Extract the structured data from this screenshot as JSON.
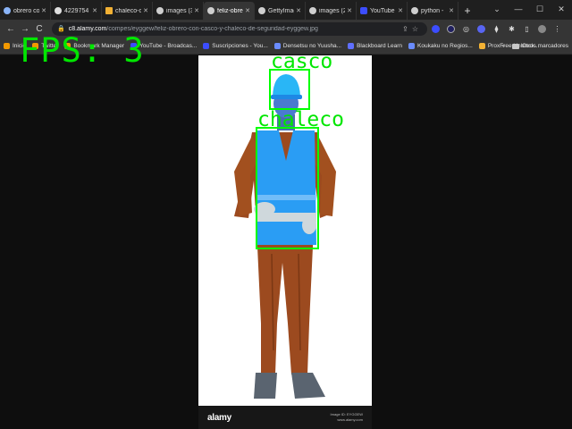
{
  "tabs": [
    {
      "title": "obrero co",
      "color": "#8ab4f8",
      "active": false
    },
    {
      "title": "4229754",
      "color": "#e0e0e0",
      "active": false
    },
    {
      "title": "chaleco-o",
      "color": "#f2b134",
      "active": false
    },
    {
      "title": "images (3",
      "color": "#cfcfcf",
      "active": false
    },
    {
      "title": "feliz-obre",
      "color": "#cfcfcf",
      "active": true
    },
    {
      "title": "GettyImag",
      "color": "#cfcfcf",
      "active": false
    },
    {
      "title": "images (2",
      "color": "#cfcfcf",
      "active": false
    },
    {
      "title": "YouTube",
      "color": "#3c4dff",
      "active": false
    },
    {
      "title": "python -",
      "color": "#cfcfcf",
      "active": false
    }
  ],
  "toolbar": {
    "back": "←",
    "forward": "→",
    "reload": "C",
    "url_domain": "c8.alamy.com",
    "url_path": "/compes/eyggew/feliz-obrero-con-casco-y-chaleco-de-seguridad-eyggew.jpg"
  },
  "bookmarks": [
    {
      "label": "Inicio",
      "color": "#f29900"
    },
    {
      "label": "Twitter",
      "color": "#f29900"
    },
    {
      "label": "Bookmark Manager",
      "color": "#f29900"
    },
    {
      "label": "YouTube - Broadcas...",
      "color": "#3c4dff"
    },
    {
      "label": "Suscripciones - You...",
      "color": "#3c4dff"
    },
    {
      "label": "Densetsu no Yuusha...",
      "color": "#6a8cff"
    },
    {
      "label": "Blackboard Learn",
      "color": "#5f6fff"
    },
    {
      "label": "Koukaku no Regios...",
      "color": "#6a8cff"
    },
    {
      "label": "ProxFree Unblock...",
      "color": "#f2b134"
    }
  ],
  "bookmarks_more": "»",
  "other_bookmarks": "Otros marcadores",
  "overlay": {
    "fps_text": "FPS: 3",
    "detections": [
      {
        "label": "casco"
      },
      {
        "label": "chaleco"
      }
    ]
  },
  "image_footer": {
    "logo": "alamy",
    "meta_line1": "Image ID: EYGGEW",
    "meta_line2": "www.alamy.com"
  },
  "colors": {
    "detection": "#00ff00",
    "vest": "#2a9df4",
    "helmet": "#29b6f6",
    "clothing": "#9c4a1f"
  }
}
